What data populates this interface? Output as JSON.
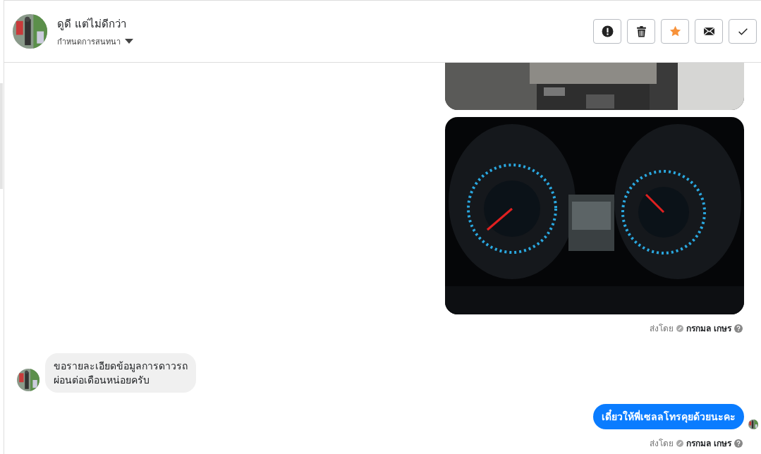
{
  "header": {
    "name": "ดูดี แต่ไม่ดีกว่า",
    "subtitle": "กำหนดการสนทนา",
    "starred": true,
    "actions": [
      {
        "kind": "alert"
      },
      {
        "kind": "trash"
      },
      {
        "kind": "star"
      },
      {
        "kind": "mail"
      },
      {
        "kind": "check"
      }
    ]
  },
  "messages": [
    {
      "kind": "clipped_picture"
    },
    {
      "kind": "picture"
    },
    {
      "kind": "sent_by",
      "label": "ส่งโดย",
      "sender": "กรกมล เกษร"
    },
    {
      "kind": "incoming",
      "text": "ขอรายละเอียดข้อมูลการดาวรถ\nผ่อนต่อเดือนหน่อยครับ"
    },
    {
      "kind": "outgoing",
      "text": "เดี๋ยวให้พี่เซลลโทรคุยด้วยนะคะ"
    },
    {
      "kind": "sent_by",
      "label": "ส่งโดย",
      "sender": "กรกมล เกษร"
    }
  ]
}
